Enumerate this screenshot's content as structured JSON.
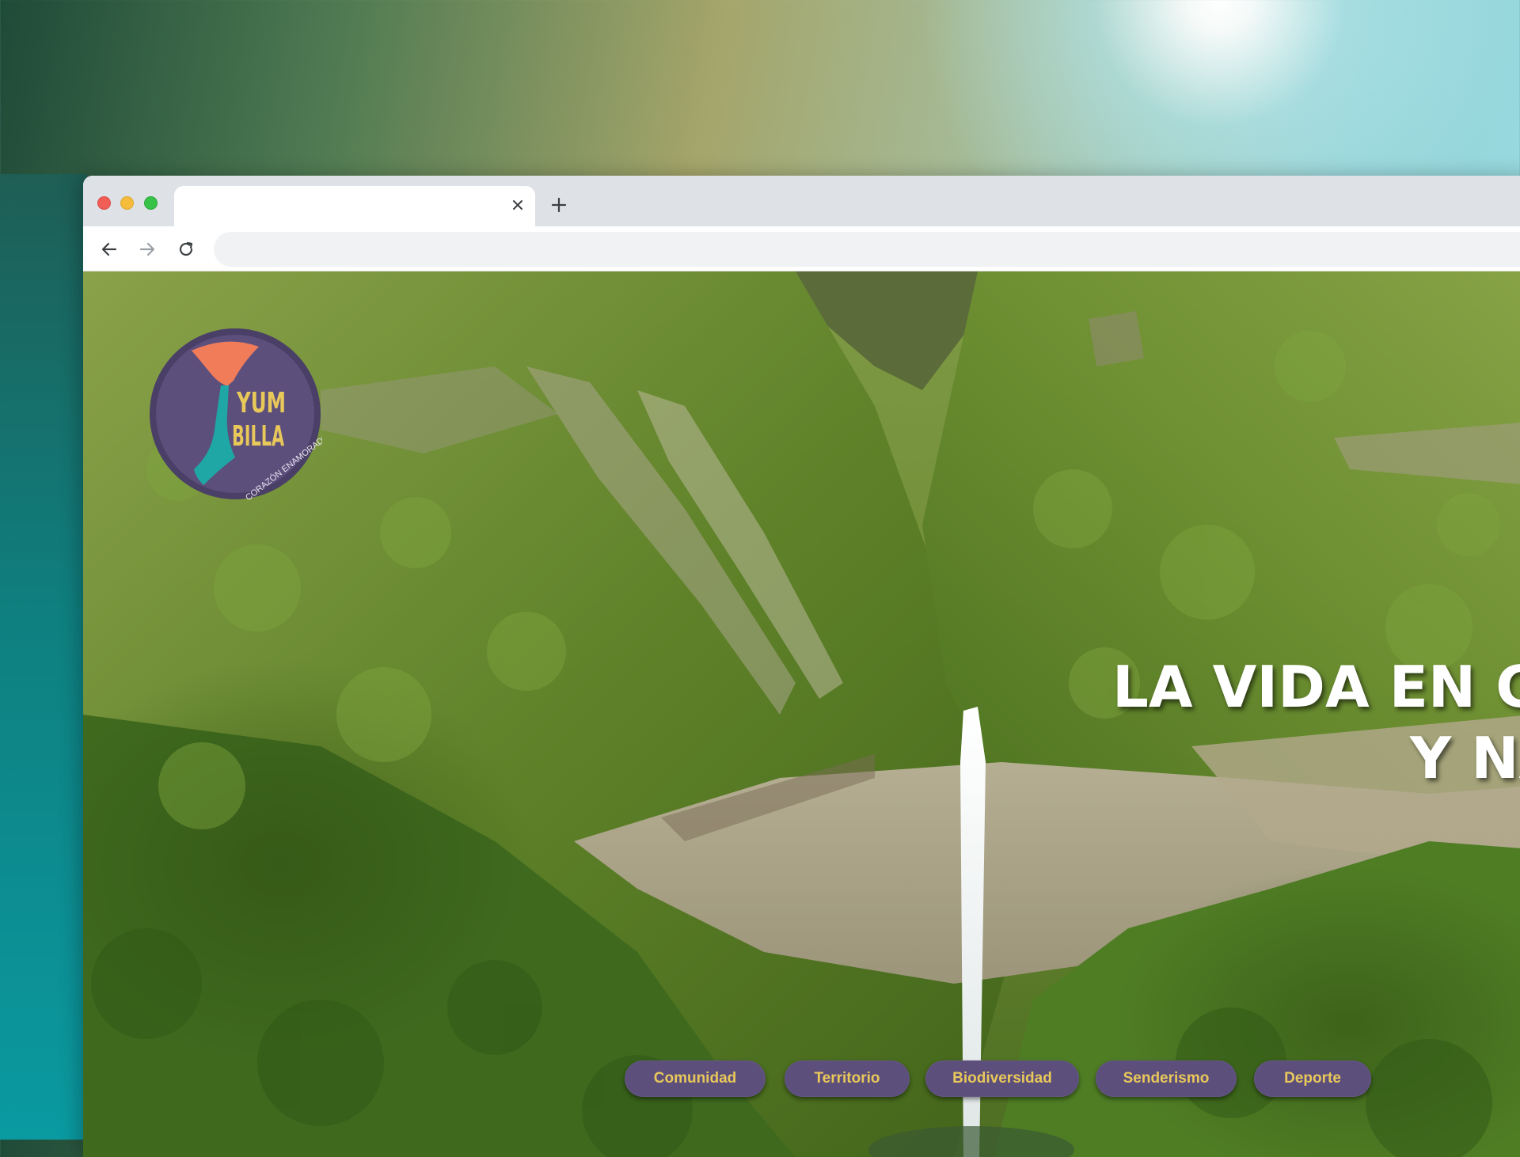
{
  "browser": {
    "tab_title": "",
    "url": "",
    "url_placeholder": ""
  },
  "logo": {
    "line1": "YUM",
    "line2": "BILLA",
    "tagline": "CORAZÓN ENAMORADO",
    "colors": {
      "circle": "#5c4f7c",
      "ring": "#4a3f66",
      "coral": "#f07c5a",
      "teal": "#1fa7a6",
      "yellow": "#e9c85a"
    }
  },
  "hero": {
    "headline_line1": "LA VIDA EN CO",
    "headline_line2": "Y NA"
  },
  "tags": [
    "Comunidad",
    "Territorio",
    "Biodiversidad",
    "Senderismo",
    "Deporte"
  ],
  "colors": {
    "tag_bg": "#5c4f7c",
    "tag_text": "#e9c85a"
  }
}
